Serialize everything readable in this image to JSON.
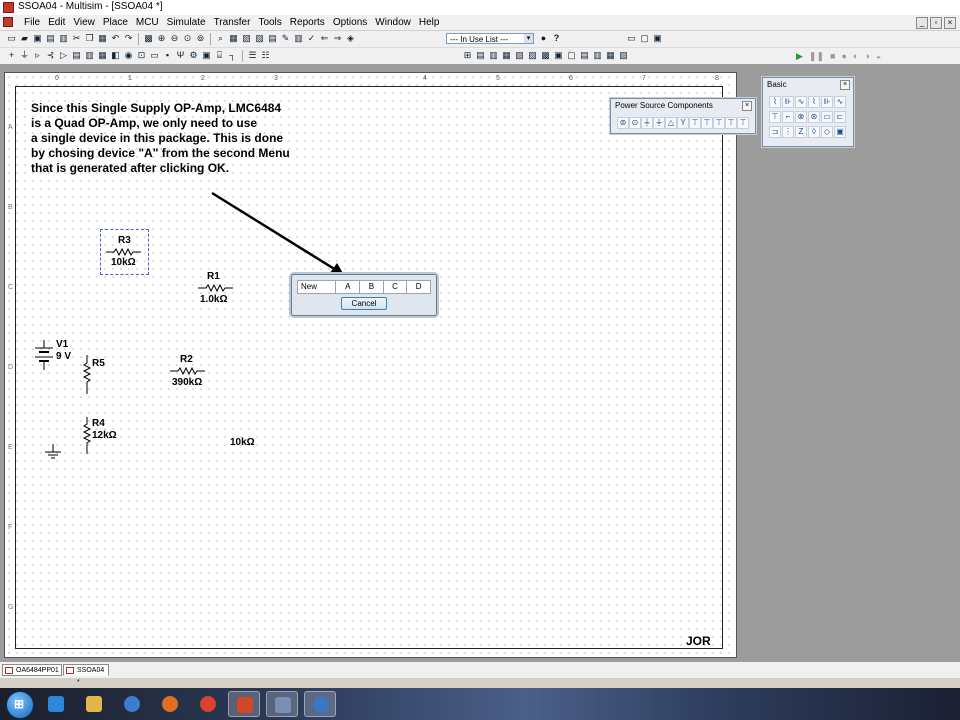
{
  "window": {
    "title": "SSOA04 - Multisim - [SSOA04 *]"
  },
  "menu": [
    "File",
    "Edit",
    "View",
    "Place",
    "MCU",
    "Simulate",
    "Transfer",
    "Tools",
    "Reports",
    "Options",
    "Window",
    "Help"
  ],
  "toolbar": {
    "in_use_list": "--- In Use List ---",
    "help_glyph": "?"
  },
  "ruler": {
    "columns": [
      "0",
      "1",
      "2",
      "3",
      "4",
      "5",
      "6",
      "7",
      "8"
    ],
    "rows": [
      "A",
      "B",
      "C",
      "D",
      "E",
      "F",
      "G"
    ]
  },
  "note": {
    "lines": [
      "Since this Single Supply OP-Amp, LMC6484",
      "is a Quad OP-Amp, we only need to use",
      "a single device in this package. This is done",
      "by chosing device \"A\" from the second Menu",
      "that is generated after clicking OK."
    ]
  },
  "components": {
    "r3": {
      "ref": "R3",
      "value": "10kΩ"
    },
    "r1": {
      "ref": "R1",
      "value": "1.0kΩ"
    },
    "v1": {
      "ref": "V1",
      "value": "9 V"
    },
    "r5": {
      "ref": "R5"
    },
    "r2": {
      "ref": "R2",
      "value": "390kΩ"
    },
    "r4": {
      "ref": "R4",
      "value": "12kΩ"
    },
    "floating_value": "10kΩ"
  },
  "dialog": {
    "columns": [
      "New",
      "A",
      "B",
      "C",
      "D"
    ],
    "cancel": "Cancel"
  },
  "palettes": {
    "power": {
      "title": "Power Source Components"
    },
    "basic": {
      "title": "Basic"
    }
  },
  "signature": "JOR",
  "tabs": [
    "OA6484PP01",
    "SSOA04 *"
  ],
  "colors": {
    "selection": "#4a5ec8",
    "simulate_run": "#1e9e2a"
  }
}
